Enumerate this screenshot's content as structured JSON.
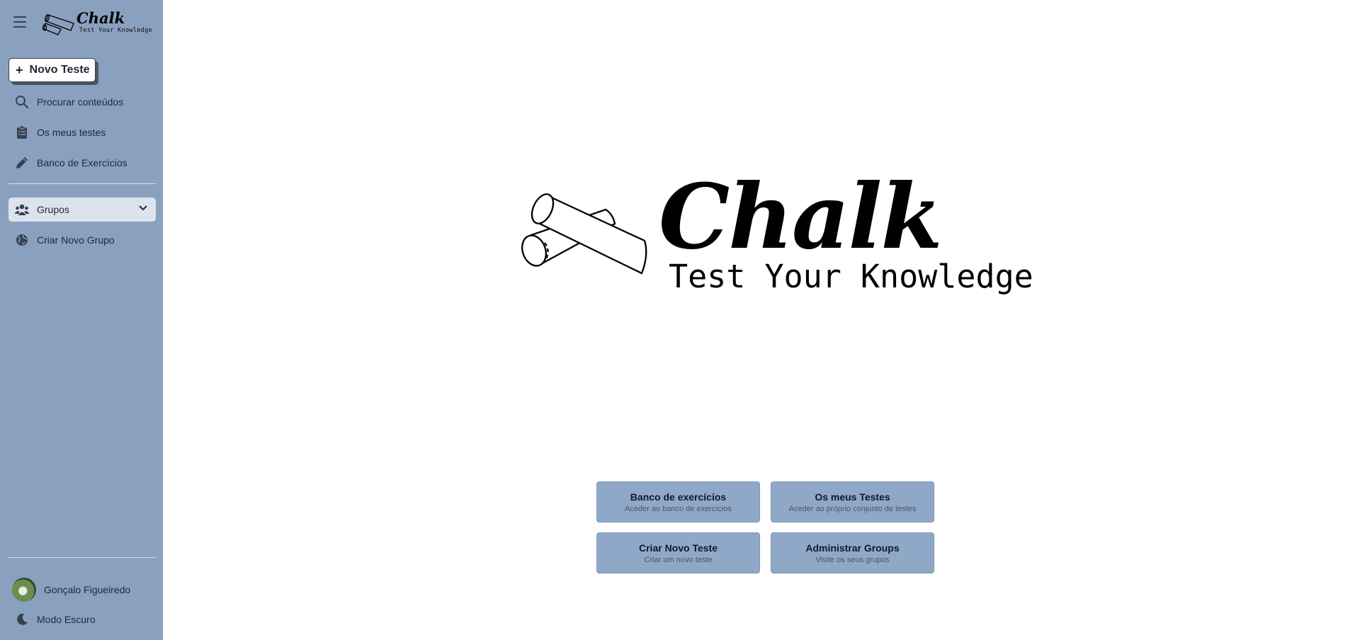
{
  "brand": {
    "title": "Chalk",
    "subtitle": "Test Your Knowledge"
  },
  "sidebar": {
    "new_test_label": "Novo Teste",
    "items": [
      {
        "label": "Procurar conteúdos",
        "icon": "search-icon"
      },
      {
        "label": "Os meus testes",
        "icon": "clipboard-icon"
      },
      {
        "label": "Banco de Exercícios",
        "icon": "pencil-icon"
      }
    ],
    "groups": {
      "label": "Grupos",
      "icon": "users-icon",
      "expanded": false
    },
    "create_group_label": "Criar Novo Grupo",
    "user_name": "Gonçalo Figueiredo",
    "dark_mode_label": "Modo Escuro"
  },
  "main": {
    "logo_title": "Chalk",
    "logo_subtitle": "Test Your Knowledge",
    "cards": [
      {
        "title": "Banco de exercícios",
        "subtitle": "Aceder ao banco de exercícios"
      },
      {
        "title": "Os meus Testes",
        "subtitle": "Aceder ao próprio conjunto de testes"
      },
      {
        "title": "Criar Novo Teste",
        "subtitle": "Criar um novo teste"
      },
      {
        "title": "Administrar Groups",
        "subtitle": "Visite os seus grupos"
      }
    ]
  },
  "colors": {
    "sidebar_bg": "#8aa0bf",
    "card_bg": "#8fa8c8",
    "active_item_bg": "#dde3ee"
  }
}
